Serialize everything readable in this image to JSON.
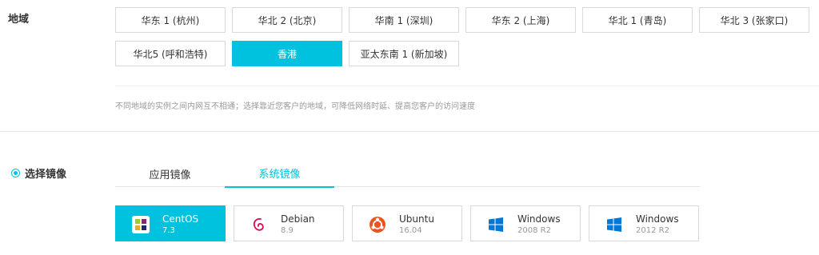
{
  "region": {
    "label": "地域",
    "options": [
      {
        "label": "华东 1 (杭州)"
      },
      {
        "label": "华北 2 (北京)"
      },
      {
        "label": "华南 1 (深圳)"
      },
      {
        "label": "华东 2 (上海)"
      },
      {
        "label": "华北 1 (青岛)"
      },
      {
        "label": "华北 3 (张家口)"
      },
      {
        "label": "华北5 (呼和浩特)"
      },
      {
        "label": "香港"
      },
      {
        "label": "亚太东南 1 (新加坡)"
      }
    ],
    "selected": "香港",
    "hint": "不同地域的实例之间内网互不相通；选择靠近您客户的地域，可降低网络时延、提高您客户的访问速度"
  },
  "image": {
    "label": "选择镜像",
    "tabs": [
      {
        "label": "应用镜像"
      },
      {
        "label": "系统镜像"
      }
    ],
    "active_tab": "系统镜像",
    "os": [
      {
        "name": "CentOS",
        "version": "7.3",
        "icon": "centos-icon"
      },
      {
        "name": "Debian",
        "version": "8.9",
        "icon": "debian-icon"
      },
      {
        "name": "Ubuntu",
        "version": "16.04",
        "icon": "ubuntu-icon"
      },
      {
        "name": "Windows",
        "version": "2008 R2",
        "icon": "windows-icon"
      },
      {
        "name": "Windows",
        "version": "2012 R2",
        "icon": "windows-icon"
      }
    ],
    "selected_os": "CentOS"
  },
  "colors": {
    "accent": "#00c1de",
    "border": "#d9d9d9",
    "hint": "#999999"
  }
}
